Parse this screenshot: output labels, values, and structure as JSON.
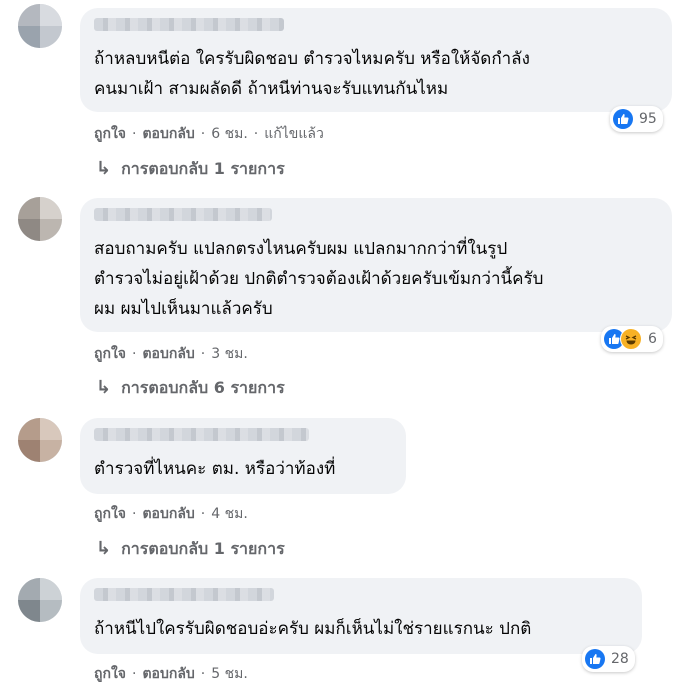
{
  "comments": [
    {
      "lines": [
        "ถ้าหลบหนีต่อ ใครรับผิดชอบ ตำรวจไหมครับ หรือให้จัดกำลัง",
        "คนมาเฝ้า สามผลัดดี ถ้าหนีท่านจะรับแทนกันไหม"
      ],
      "like_label": "ถูกใจ",
      "reply_label": "ตอบกลับ",
      "time": "6 ชม.",
      "edited": "แก้ไขแล้ว",
      "reactions": [
        "like"
      ],
      "reaction_count": "95",
      "replies_label": "การตอบกลับ 1 รายการ"
    },
    {
      "lines": [
        "สอบถามครับ แปลกตรงไหนครับผม แปลกมากกว่าที่ในรูป",
        "ตำรวจไม่อยู่เฝ้าด้วย ปกติตำรวจต้องเฝ้าด้วยครับเข้มกว่านี้ครับ",
        "ผม ผมไปเห็นมาแล้วครับ"
      ],
      "like_label": "ถูกใจ",
      "reply_label": "ตอบกลับ",
      "time": "3 ชม.",
      "reactions": [
        "like",
        "haha"
      ],
      "reaction_count": "6",
      "replies_label": "การตอบกลับ 6 รายการ"
    },
    {
      "lines": [
        "ตำรวจที่ไหนคะ ตม. หรือว่าท้องที่"
      ],
      "like_label": "ถูกใจ",
      "reply_label": "ตอบกลับ",
      "time": "4 ชม.",
      "replies_label": "การตอบกลับ 1 รายการ"
    },
    {
      "lines": [
        "ถ้าหนีไปใครรับผิดชอบอ่ะครับ ผมก็เห็นไม่ใช่รายแรกนะ ปกติ"
      ],
      "like_label": "ถูกใจ",
      "reply_label": "ตอบกลับ",
      "time": "5 ชม.",
      "reactions": [
        "like"
      ],
      "reaction_count": "28"
    }
  ],
  "separator": "·",
  "reply_arrow": "↳",
  "colors": {
    "like": "#1877f2",
    "haha": "#f7b125",
    "bubble": "#f0f2f5",
    "meta": "#65676b"
  }
}
